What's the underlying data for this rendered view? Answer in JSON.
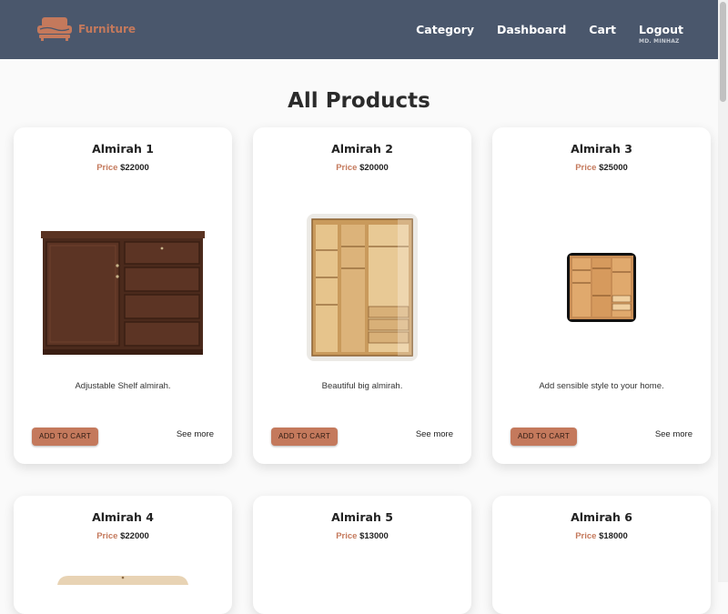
{
  "navbar": {
    "brand": "Furniture",
    "links": [
      "Category",
      "Dashboard",
      "Cart",
      "Logout"
    ],
    "user": "MD. MINHAZ"
  },
  "page": {
    "title": "All Products"
  },
  "products": [
    {
      "name": "Almirah 1",
      "price_label": "Price",
      "price": "$22000",
      "description": "Adjustable Shelf almirah.",
      "add_label": "ADD TO CART",
      "more_label": "See more"
    },
    {
      "name": "Almirah 2",
      "price_label": "Price",
      "price": "$20000",
      "description": "Beautiful big almirah.",
      "add_label": "ADD TO CART",
      "more_label": "See more"
    },
    {
      "name": "Almirah 3",
      "price_label": "Price",
      "price": "$25000",
      "description": "Add sensible style to your home.",
      "add_label": "ADD TO CART",
      "more_label": "See more"
    },
    {
      "name": "Almirah 4",
      "price_label": "Price",
      "price": "$22000"
    },
    {
      "name": "Almirah 5",
      "price_label": "Price",
      "price": "$13000"
    },
    {
      "name": "Almirah 6",
      "price_label": "Price",
      "price": "$18000"
    }
  ],
  "colors": {
    "navbar": "#4a576c",
    "accent": "#c4795c"
  }
}
